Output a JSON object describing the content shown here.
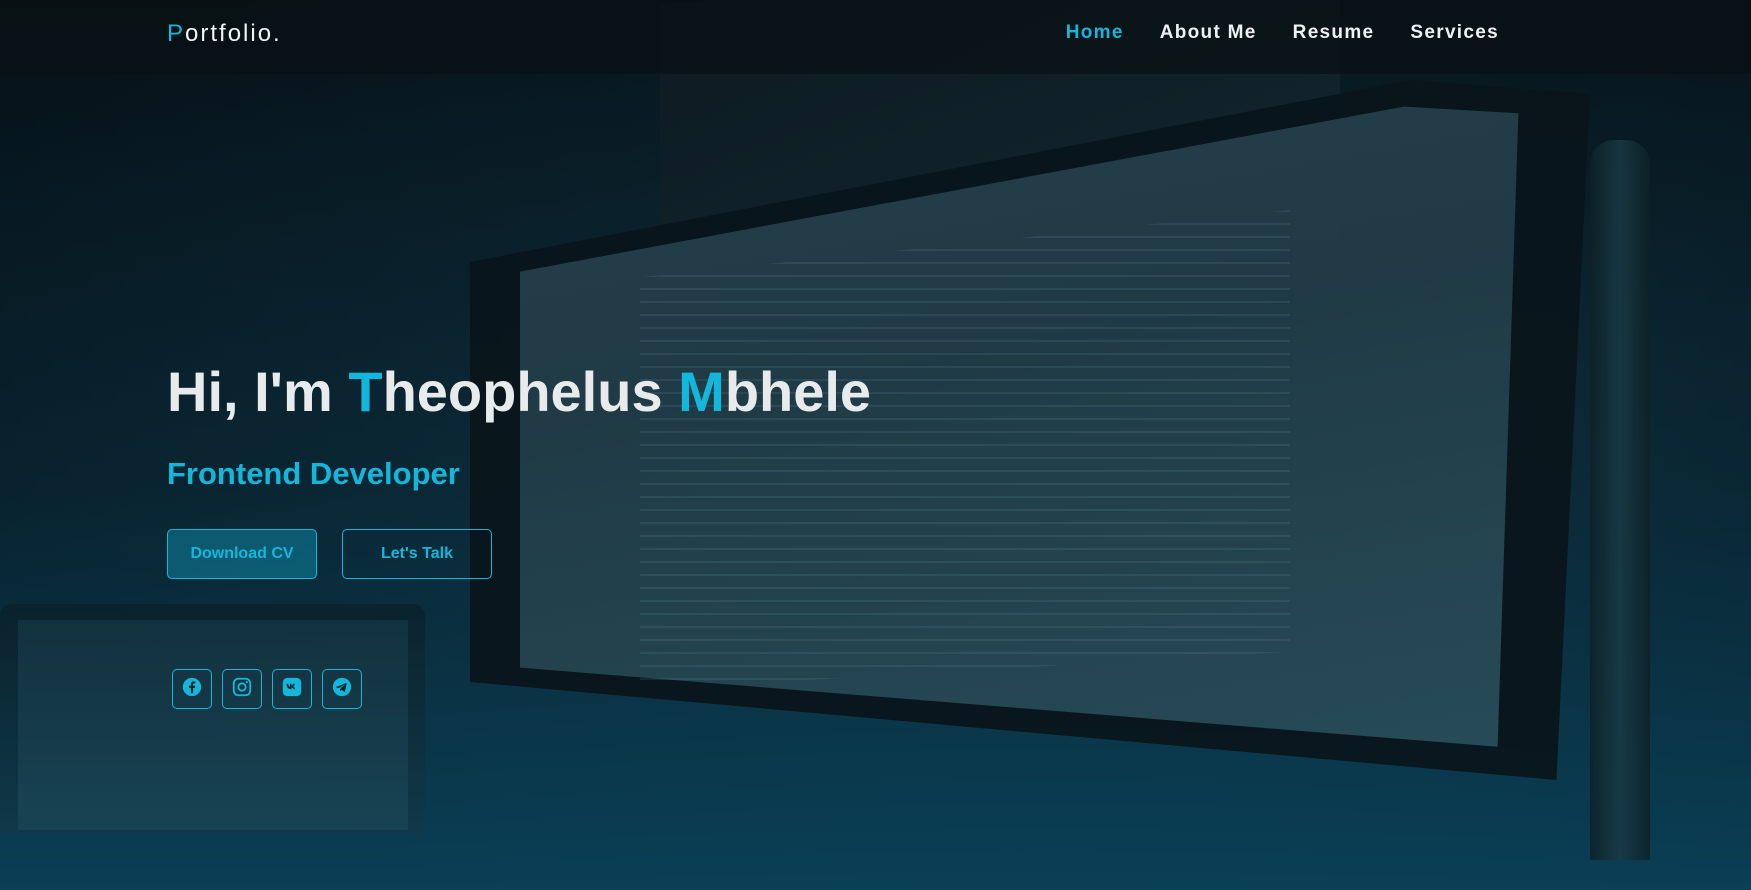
{
  "logo": {
    "first": "P",
    "rest": "ortfolio."
  },
  "nav": {
    "items": [
      {
        "label": "Home",
        "active": true
      },
      {
        "label": "About Me",
        "active": false
      },
      {
        "label": "Resume",
        "active": false
      },
      {
        "label": "Services",
        "active": false
      }
    ]
  },
  "hero": {
    "greeting": "Hi, I'm ",
    "first_initial": "T",
    "first_rest": "heophelus ",
    "last_initial": "M",
    "last_rest": "bhele",
    "subtitle": "Frontend Developer",
    "download_label": "Download CV",
    "talk_label": "Let's Talk"
  },
  "social": {
    "icons": [
      "facebook-icon",
      "instagram-icon",
      "vk-icon",
      "telegram-icon"
    ]
  },
  "colors": {
    "accent": "#12b8dc",
    "text": "#e8ebec",
    "nav_bg": "#0a1014"
  }
}
